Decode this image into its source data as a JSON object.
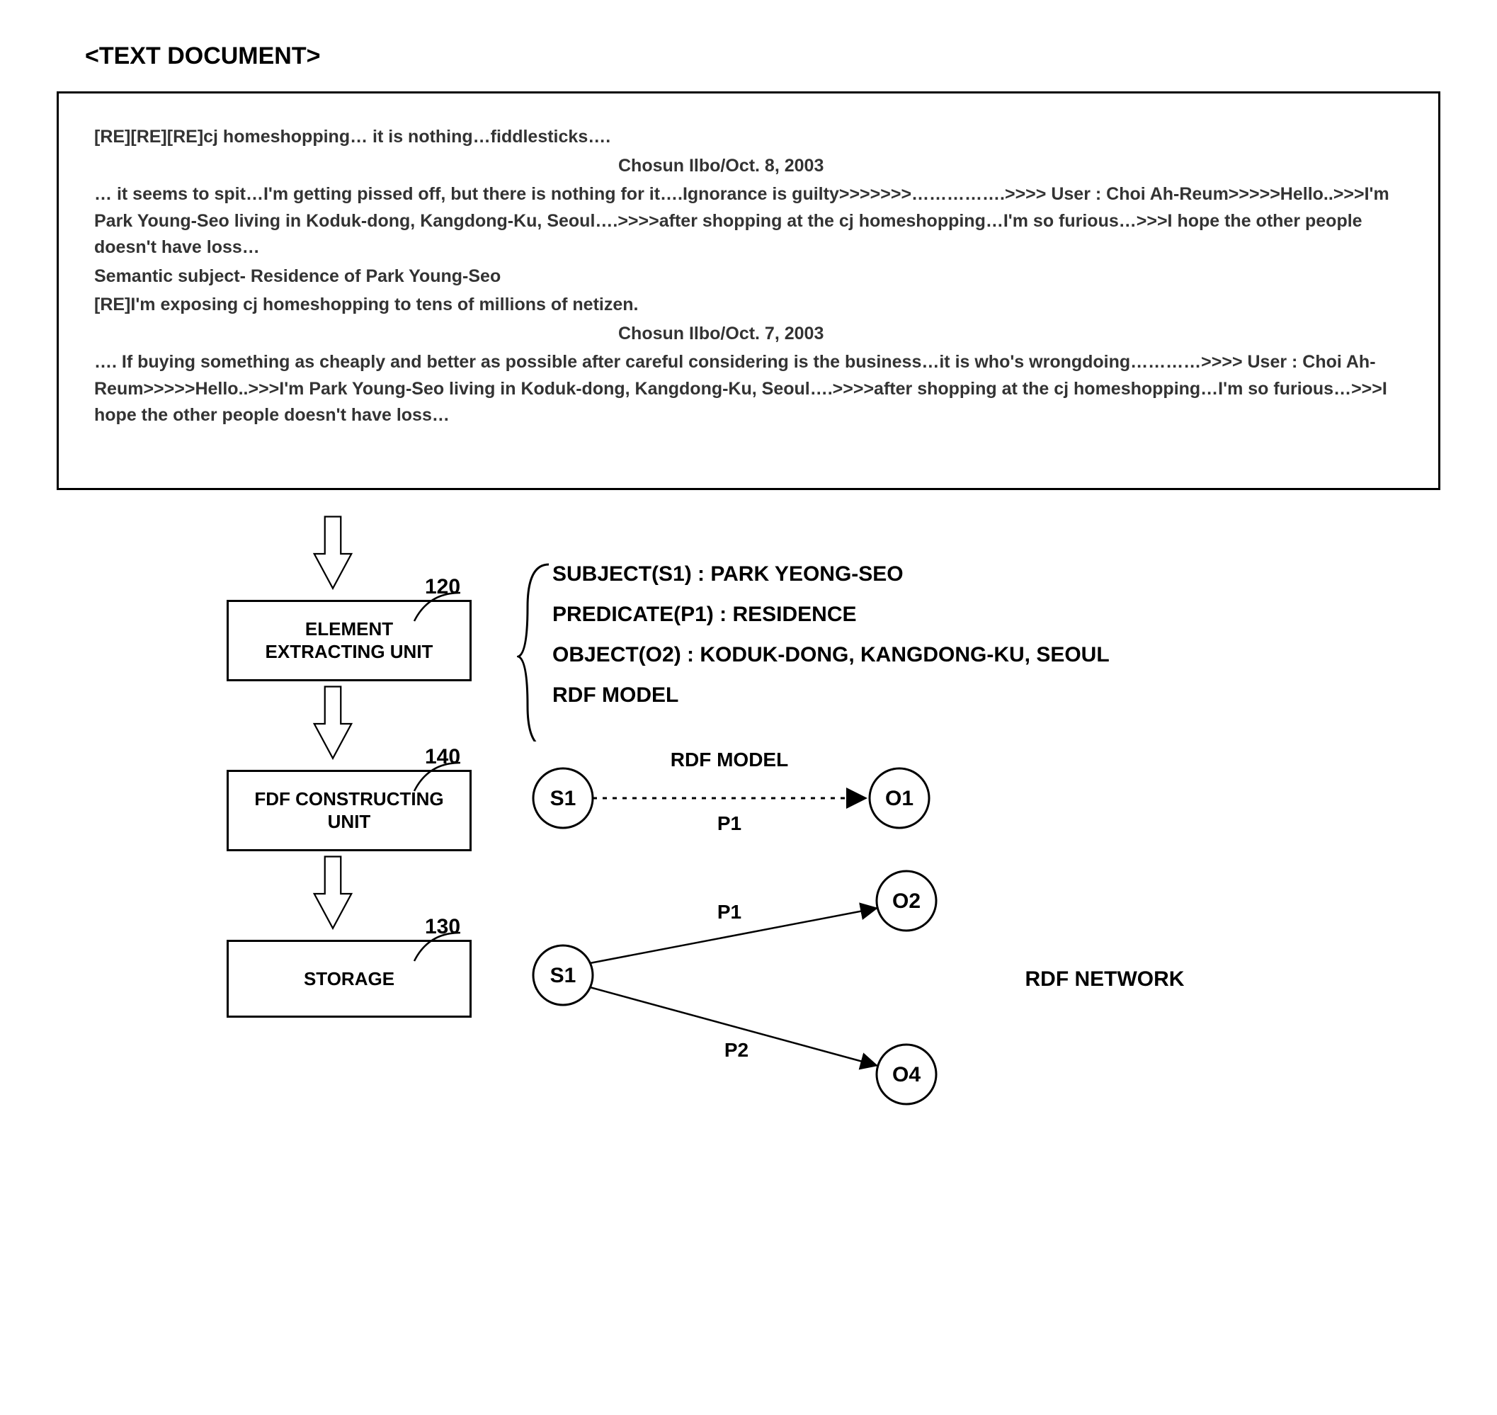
{
  "title": "<TEXT DOCUMENT>",
  "doc": {
    "l1": "[RE][RE][RE]cj homeshopping… it is nothing…fiddlesticks….",
    "l2": "Chosun Ilbo/Oct. 8, 2003",
    "l3": "… it seems to spit…I'm getting pissed off, but there is nothing for it….Ignorance is guilty>>>>>>>…………….>>>> User : Choi Ah-Reum>>>>>Hello..>>>I'm Park Young-Seo living in Koduk-dong, Kangdong-Ku, Seoul….>>>>after shopping at the cj homeshopping…I'm so furious…>>>I hope the other people doesn't have loss…",
    "l4": "Semantic subject- Residence of Park Young-Seo",
    "l5": "[RE]I'm exposing cj homeshopping to tens of millions of netizen.",
    "l6": "Chosun Ilbo/Oct. 7, 2003",
    "l7": "…. If buying something as cheaply and better as possible after careful considering is the business…it is who's wrongdoing…………>>>> User : Choi Ah-Reum>>>>>Hello..>>>I'm Park Young-Seo living in Koduk-dong, Kangdong-Ku, Seoul….>>>>after shopping at the cj homeshopping…I'm so furious…>>>I hope the other people doesn't have loss…"
  },
  "refs": {
    "r120": "120",
    "r140": "140",
    "r130": "130"
  },
  "units": {
    "extract_l1": "ELEMENT",
    "extract_l2": "EXTRACTING UNIT",
    "fdf_l1": "FDF CONSTRUCTING",
    "fdf_l2": "UNIT",
    "storage": "STORAGE"
  },
  "triple": {
    "subject": "SUBJECT(S1) : PARK YEONG-SEO",
    "predicate": "PREDICATE(P1) : RESIDENCE",
    "object": "OBJECT(O2) : KODUK-DONG, KANGDONG-KU, SEOUL",
    "rdfmodel": "RDF MODEL"
  },
  "model": {
    "title": "RDF MODEL",
    "s1": "S1",
    "o1": "O1",
    "p1": "P1"
  },
  "network": {
    "title": "RDF NETWORK",
    "s1": "S1",
    "o2": "O2",
    "o4": "O4",
    "p1": "P1",
    "p2": "P2"
  }
}
